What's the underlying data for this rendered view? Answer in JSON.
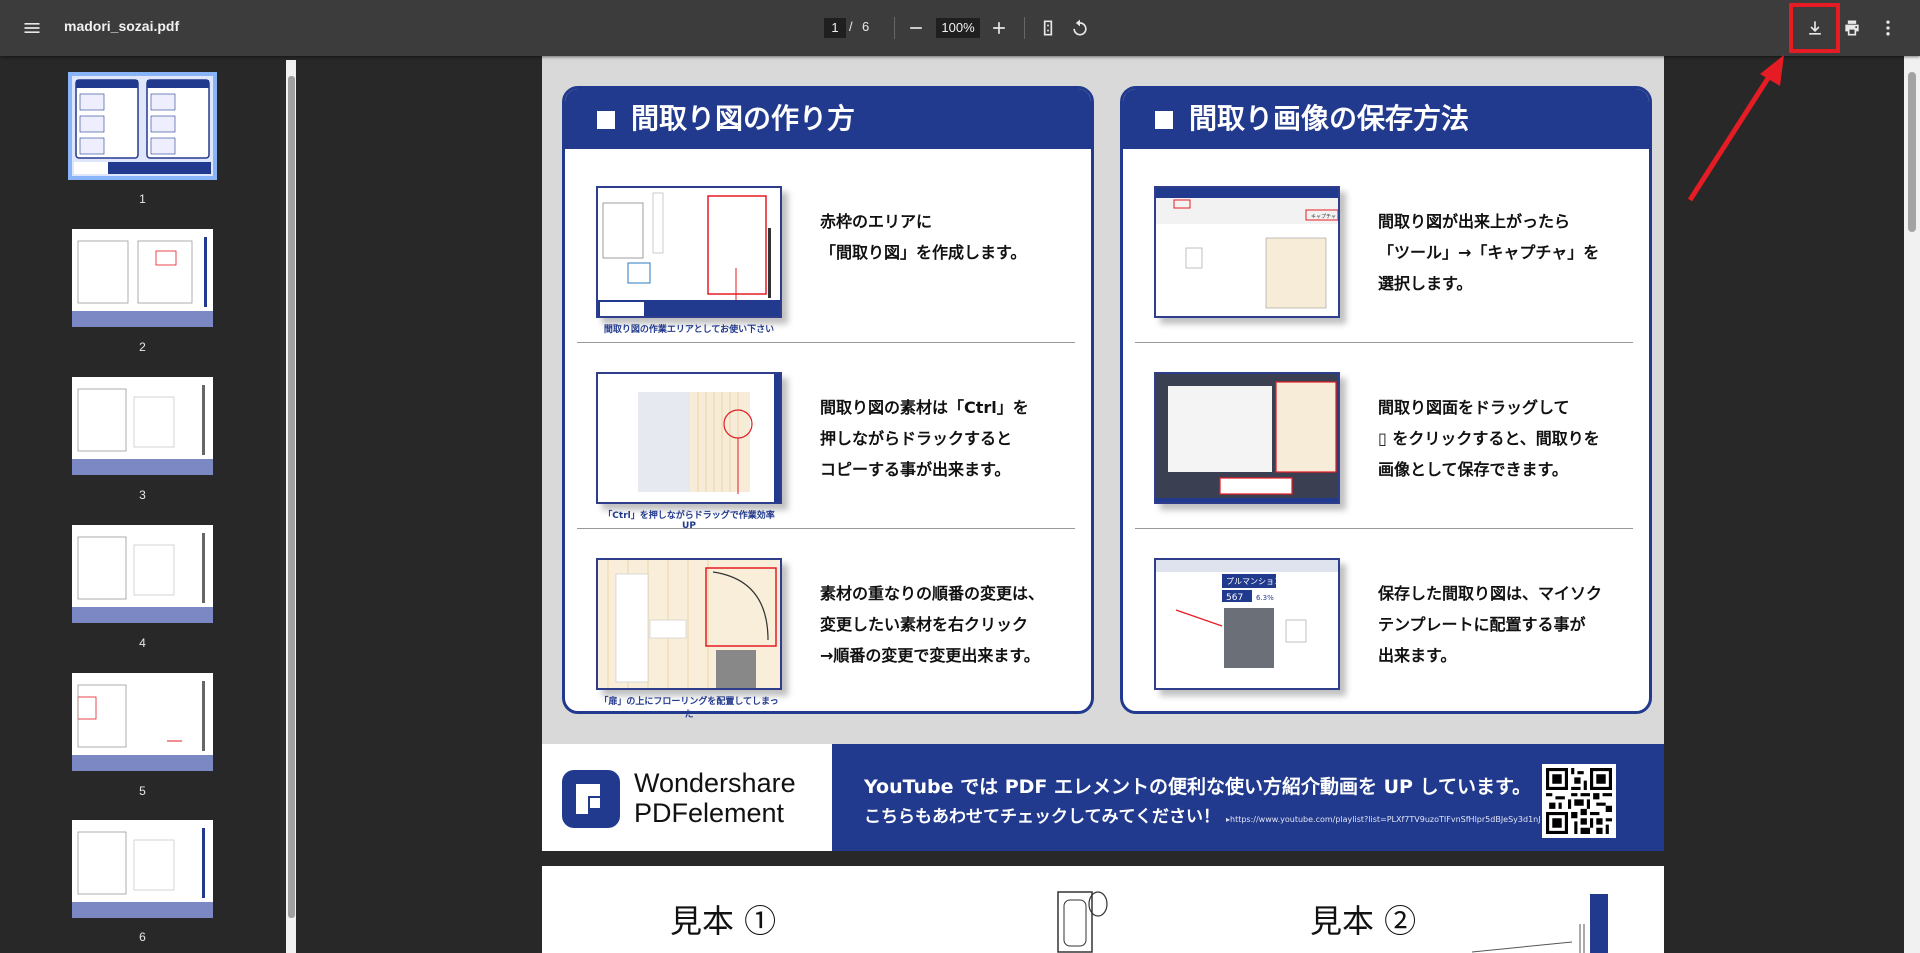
{
  "toolbar": {
    "file_name": "madori_sozai.pdf",
    "current_page": "1",
    "page_separator": "/",
    "total_pages": "6",
    "zoom": "100%"
  },
  "icons": {
    "menu": "menu-icon",
    "zoom_out": "minus-icon",
    "zoom_in": "plus-icon",
    "fit_page": "fit-page-icon",
    "rotate": "rotate-icon",
    "download": "download-icon",
    "print": "print-icon",
    "more": "more-vert-icon"
  },
  "colors": {
    "toolbar_bg": "#3c3c3c",
    "viewer_bg": "#282828",
    "brand_blue": "#223a8d",
    "annotation_red": "#e51c23",
    "active_thumb": "#8ab4f8"
  },
  "thumbnails": [
    {
      "label": "1"
    },
    {
      "label": "2"
    },
    {
      "label": "3"
    },
    {
      "label": "4"
    },
    {
      "label": "5"
    },
    {
      "label": "6"
    }
  ],
  "page": {
    "left_panel": {
      "title": "間取り図の作り方",
      "rows": [
        {
          "caption": "間取り図の作業エリアとしてお使い下さい",
          "text": "赤枠のエリアに\n「間取り図」を作成します。"
        },
        {
          "caption": "「Ctrl」を押しながらドラッグで作業効率 UP",
          "text": "間取り図の素材は「Ctrl」を\n押しながらドラックすると\nコピーする事が出来ます。"
        },
        {
          "caption": "「扉」の上にフローリングを配置してしまった",
          "text": "素材の重なりの順番の変更は、\n変更したい素材を右クリック\n→順番の変更で変更出来ます。"
        }
      ]
    },
    "right_panel": {
      "title": "間取り画像の保存方法",
      "rows": [
        {
          "text": "間取り図が出来上がったら\n「ツール」→「キャプチャ」を\n選択します。"
        },
        {
          "text": "間取り図面をドラッグして\n▯ をクリックすると、間取りを\n画像として保存できます。"
        },
        {
          "text": "保存した間取り図は、マイソク\nテンプレートに配置する事が\n出来ます。"
        }
      ]
    },
    "banner": {
      "logo_text": "Wondershare\nPDFelement",
      "line1": "YouTube では PDF エレメントの便利な使い方紹介動画を UP しています。",
      "line2": "こちらもあわせてチェックしてみてください！",
      "url": "▸https://www.youtube.com/playlist?list=PLXf7TV9uzoTIFvnSfHlpr5dBJeSy3d1nJ"
    },
    "insets": {
      "right_row1_tab": "キャプチャ",
      "right_row3_heading": "プルマンション",
      "right_row3_value": "567",
      "right_row3_badge": "6.3%"
    }
  },
  "page2": {
    "sample1": "見本 ①",
    "sample2": "見本 ②"
  }
}
